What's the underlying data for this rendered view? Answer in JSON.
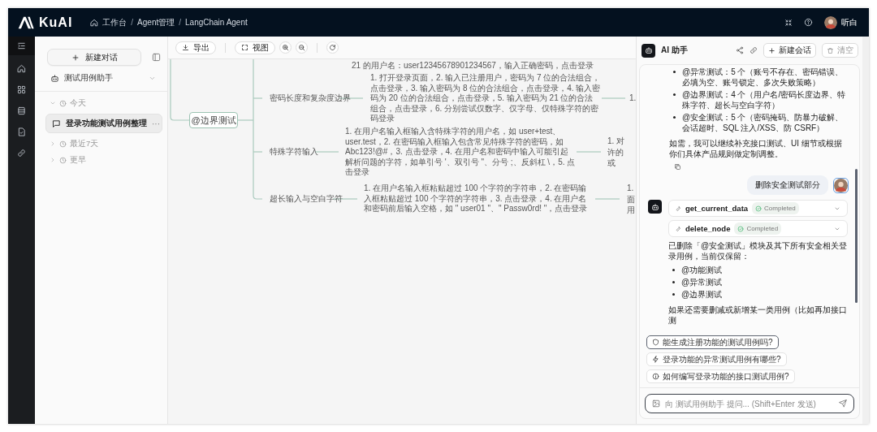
{
  "header": {
    "logo": "KuAI",
    "breadcrumbs": [
      "工作台",
      "Agent管理",
      "LangChain Agent"
    ],
    "separator": "/",
    "user": "听白"
  },
  "sidebar": {
    "new_chat": "新建对话",
    "agent": "测试用例助手",
    "groups": [
      {
        "label": "今天",
        "expanded": true,
        "items": [
          {
            "title": "登录功能测试用例整理",
            "selected": true,
            "more": "···"
          }
        ]
      },
      {
        "label": "最近7天",
        "expanded": false
      },
      {
        "label": "更早",
        "expanded": false
      }
    ]
  },
  "toolbar": {
    "export": "导出",
    "view": "视图"
  },
  "mindmap": {
    "top_fragment": "21 的用户名：user12345678901234567，输入正确密码，点击登录",
    "node": "@边界测试",
    "branches": [
      {
        "label": "密码长度和复杂度边界",
        "detail": "1. 打开登录页面，2. 输入已注册用户，密码为 7 位的合法组合，点击登录，3. 输入密码为 8 位的合法组合，点击登录，4. 输入密码为 20 位的合法组合，点击登录，5. 输入密码为 21 位的合法组合，点击登录，6. 分别尝试仅数字、仅字母、仅特殊字符的密码登录",
        "next": [
          "1."
        ]
      },
      {
        "label": "特殊字符输入",
        "detail": "1. 在用户名输入框输入含特殊字符的用户名，如 user+test、user.test，2. 在密码输入框输入包含常见特殊字符的密码，如 Abc123!@#，3. 点击登录，4. 在用户名和密码中输入可能引起解析问题的字符，如单引号 '、双引号 \"、分号 ;、反斜杠 \\，5. 点击登录",
        "next": [
          "1. 对",
          "许的",
          "或"
        ]
      },
      {
        "label": "超长输入与空白字符",
        "detail": "1. 在用户名输入框粘贴超过 100 个字符的字符串，2. 在密码输入框粘贴超过 100 个字符的字符串，3. 点击登录，4. 在用户名和密码前后输入空格，如 \" user01 \"、\" Passw0rd! \"，点击登录",
        "next": [
          "1.",
          "面",
          "用"
        ]
      }
    ]
  },
  "chat": {
    "title": "AI 助手",
    "new_chat": "新建会话",
    "clear": "清空",
    "messages": [
      {
        "kind": "assistant",
        "avatar": false,
        "bullets": [
          "@异常测试：5 个（账号不存在、密码错误、必填为空、账号锁定、多次失败策略）",
          "@边界测试：4 个（用户名/密码长度边界、特殊字符、超长与空白字符）",
          "@安全测试：5 个（密码掩码、防暴力破解、会话超时、SQL 注入/XSS、防 CSRF）"
        ],
        "after": "如需，我可以继续补充接口测试、UI 细节或根据你们具体产品规则做定制调整。",
        "copy": true
      },
      {
        "kind": "user",
        "text": "删除安全测试部分"
      },
      {
        "kind": "assistant",
        "avatar": true,
        "tools": [
          {
            "name": "get_current_data",
            "status": "Completed",
            "completed": true
          },
          {
            "name": "delete_node",
            "status": "Completed",
            "completed": true
          }
        ],
        "before": "已删除「@安全测试」模块及其下所有安全相关登录用例，当前仅保留：",
        "bullets": [
          "@功能测试",
          "@异常测试",
          "@边界测试"
        ],
        "after": "如果还需要删减或新增某一类用例（比如再加接口测",
        "copy": false
      }
    ],
    "suggestions": [
      {
        "text": "能生成注册功能的测试用例吗?",
        "selected": true
      },
      {
        "text": "登录功能的异常测试用例有哪些?",
        "selected": false
      },
      {
        "text": "如何编写登录功能的接口测试用例?",
        "selected": false
      }
    ],
    "input_placeholder": "向 测试用例助手 提问... (Shift+Enter 发送)"
  }
}
